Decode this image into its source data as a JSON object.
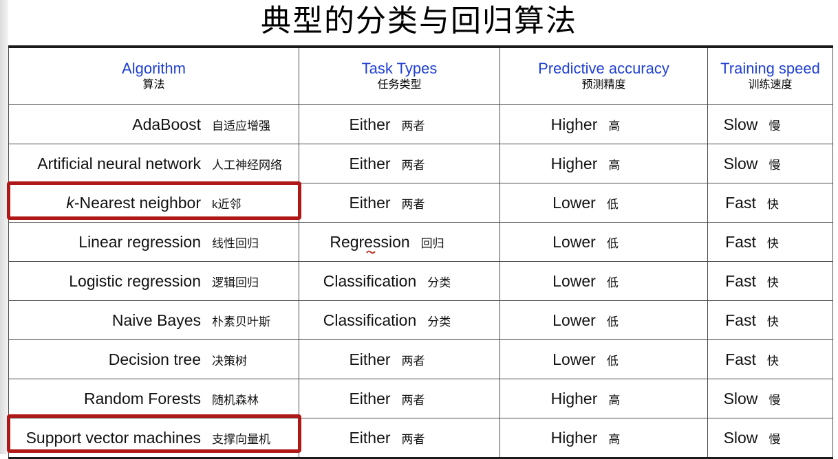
{
  "title": "典型的分类与回归算法",
  "headers": [
    {
      "en": "Algorithm",
      "zh": "算法"
    },
    {
      "en": "Task Types",
      "zh": "任务类型"
    },
    {
      "en": "Predictive accuracy",
      "zh": "预测精度"
    },
    {
      "en": "Training speed",
      "zh": "训练速度"
    }
  ],
  "rows": [
    {
      "algorithm": "AdaBoost",
      "algorithm_zh": "自适应增强",
      "task": "Either",
      "task_zh": "两者",
      "accuracy": "Higher",
      "accuracy_zh": "高",
      "speed": "Slow",
      "speed_zh": "慢"
    },
    {
      "algorithm": "Artificial neural network",
      "algorithm_zh": "人工神经网络",
      "task": "Either",
      "task_zh": "两者",
      "accuracy": "Higher",
      "accuracy_zh": "高",
      "speed": "Slow",
      "speed_zh": "慢"
    },
    {
      "algorithm_prefix": "k",
      "algorithm": "-Nearest neighbor",
      "algorithm_zh": "k近邻",
      "task": "Either",
      "task_zh": "两者",
      "accuracy": "Lower",
      "accuracy_zh": "低",
      "speed": "Fast",
      "speed_zh": "快"
    },
    {
      "algorithm": "Linear regression",
      "algorithm_zh": "线性回归",
      "task": "Regression",
      "task_zh": "回归",
      "accuracy": "Lower",
      "accuracy_zh": "低",
      "speed": "Fast",
      "speed_zh": "快"
    },
    {
      "algorithm": "Logistic regression",
      "algorithm_zh": "逻辑回归",
      "task": "Classification",
      "task_zh": "分类",
      "accuracy": "Lower",
      "accuracy_zh": "低",
      "speed": "Fast",
      "speed_zh": "快"
    },
    {
      "algorithm": "Naive Bayes",
      "algorithm_zh": "朴素贝叶斯",
      "task": "Classification",
      "task_zh": "分类",
      "accuracy": "Lower",
      "accuracy_zh": "低",
      "speed": "Fast",
      "speed_zh": "快"
    },
    {
      "algorithm": "Decision tree",
      "algorithm_zh": "决策树",
      "task": "Either",
      "task_zh": "两者",
      "accuracy": "Lower",
      "accuracy_zh": "低",
      "speed": "Fast",
      "speed_zh": "快"
    },
    {
      "algorithm": "Random Forests",
      "algorithm_zh": "随机森林",
      "task": "Either",
      "task_zh": "两者",
      "accuracy": "Higher",
      "accuracy_zh": "高",
      "speed": "Slow",
      "speed_zh": "慢"
    },
    {
      "algorithm": "Support vector machines",
      "algorithm_zh": "支撑向量机",
      "task": "Either",
      "task_zh": "两者",
      "accuracy": "Higher",
      "accuracy_zh": "高",
      "speed": "Slow",
      "speed_zh": "慢"
    }
  ],
  "colors": {
    "header_text": "#1e3fd1",
    "highlight": "#b01818"
  }
}
